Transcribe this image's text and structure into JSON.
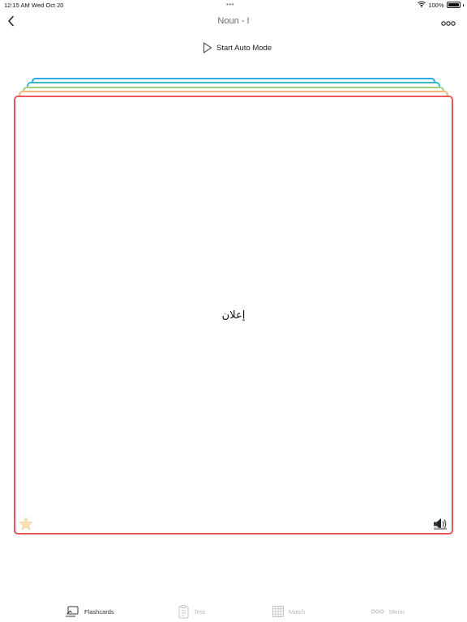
{
  "status_bar": {
    "time": "12:15 AM",
    "date": "Wed Oct 20",
    "multitask_dots": "•••",
    "wifi_icon": "wifi-icon",
    "battery_percent": "100%",
    "battery_icon": "battery-icon"
  },
  "nav": {
    "back_icon": "chevron-left-icon",
    "title": "Noun - I",
    "more_icon": "more-dots-icon"
  },
  "auto_mode": {
    "icon": "play-icon",
    "label": "Start Auto Mode"
  },
  "card": {
    "word": "إعلان",
    "star_icon": "star-icon",
    "speaker_icon": "speaker-icon"
  },
  "stack_colors": [
    "#29a9e0",
    "#35b8d0",
    "#9ccf7e",
    "#f5b87a",
    "#e9575b"
  ],
  "tabs": [
    {
      "label": "Flashcards",
      "icon": "flashcards-icon",
      "active": true
    },
    {
      "label": "Test",
      "icon": "clipboard-icon",
      "active": false
    },
    {
      "label": "Match",
      "icon": "grid-icon",
      "active": false
    },
    {
      "label": "Menu",
      "icon": "more-dots-icon",
      "active": false
    }
  ],
  "colors": {
    "active_tab": "#333333",
    "inactive_tab": "#b9b9b9",
    "star": "#f7dfb0"
  }
}
